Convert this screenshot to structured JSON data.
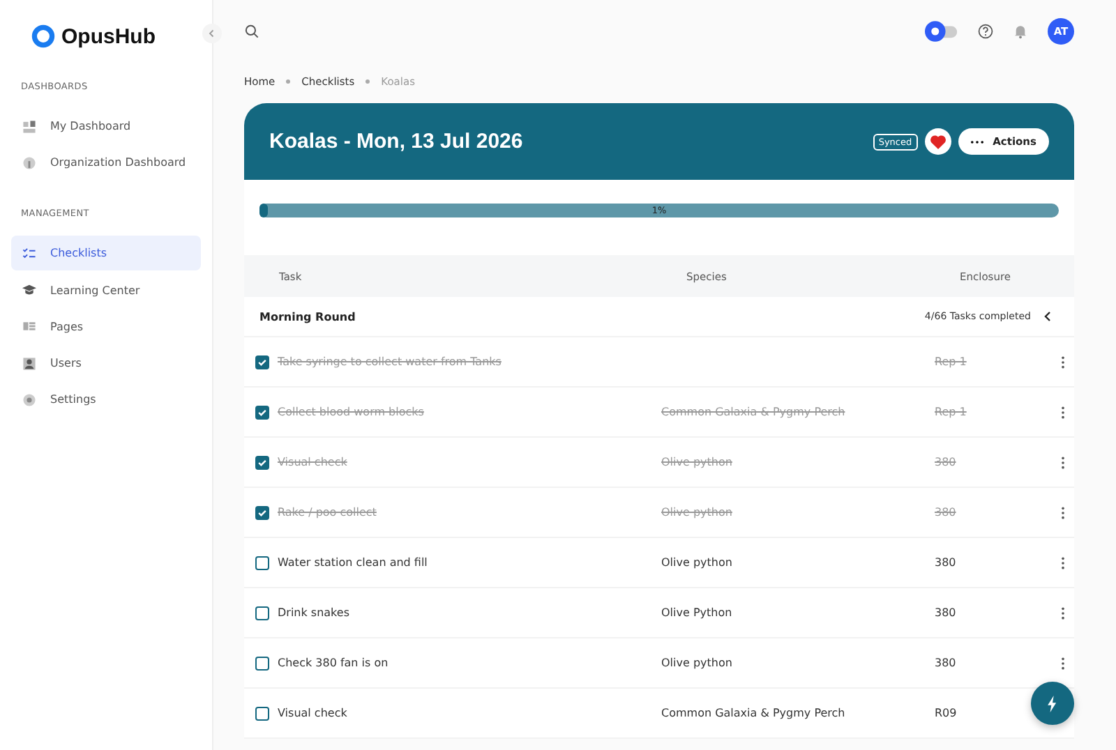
{
  "brand": "OpusHub",
  "sidebar": {
    "sections": [
      {
        "heading": "DASHBOARDS",
        "items": [
          {
            "label": "My Dashboard",
            "selected": false
          },
          {
            "label": "Organization Dashboard",
            "selected": false
          }
        ]
      },
      {
        "heading": "MANAGEMENT",
        "items": [
          {
            "label": "Checklists",
            "selected": true
          },
          {
            "label": "Learning Center",
            "selected": false
          },
          {
            "label": "Pages",
            "selected": false
          },
          {
            "label": "Users",
            "selected": false
          },
          {
            "label": "Settings",
            "selected": false
          }
        ]
      }
    ]
  },
  "user_initials": "AT",
  "breadcrumb": [
    {
      "label": "Home",
      "current": false
    },
    {
      "label": "Checklists",
      "current": false
    },
    {
      "label": "Koalas",
      "current": true
    }
  ],
  "checklist": {
    "title": "Koalas - Mon, 13 Jul 2026",
    "sync_status": "Synced",
    "favorite": true,
    "actions_label": "Actions",
    "progress": {
      "level": 0.01,
      "label": "1%"
    }
  },
  "table": {
    "columns": [
      "Task",
      "Species",
      "Enclosure"
    ],
    "group": {
      "title": "Morning Round",
      "summary": "4/66 Tasks completed"
    },
    "rows": [
      {
        "task": "Take syringe to collect water from Tanks",
        "species": "",
        "enclosure": "Rep 1",
        "checked": true
      },
      {
        "task": "Collect blood worm blocks",
        "species": "Common Galaxia & Pygmy Perch",
        "enclosure": "Rep 1",
        "checked": true
      },
      {
        "task": "Visual check",
        "species": "Olive python",
        "enclosure": "380",
        "checked": true
      },
      {
        "task": "Rake / poo collect",
        "species": "Olive python",
        "enclosure": "380",
        "checked": true
      },
      {
        "task": "Water station clean and fill",
        "species": "Olive python",
        "enclosure": "380",
        "checked": false
      },
      {
        "task": "Drink snakes",
        "species": "Olive Python",
        "enclosure": "380",
        "checked": false
      },
      {
        "task": "Check 380 fan is on",
        "species": "Olive python",
        "enclosure": "380",
        "checked": false
      },
      {
        "task": "Visual check",
        "species": "Common Galaxia & Pygmy Perch",
        "enclosure": "R09",
        "checked": false
      }
    ]
  }
}
